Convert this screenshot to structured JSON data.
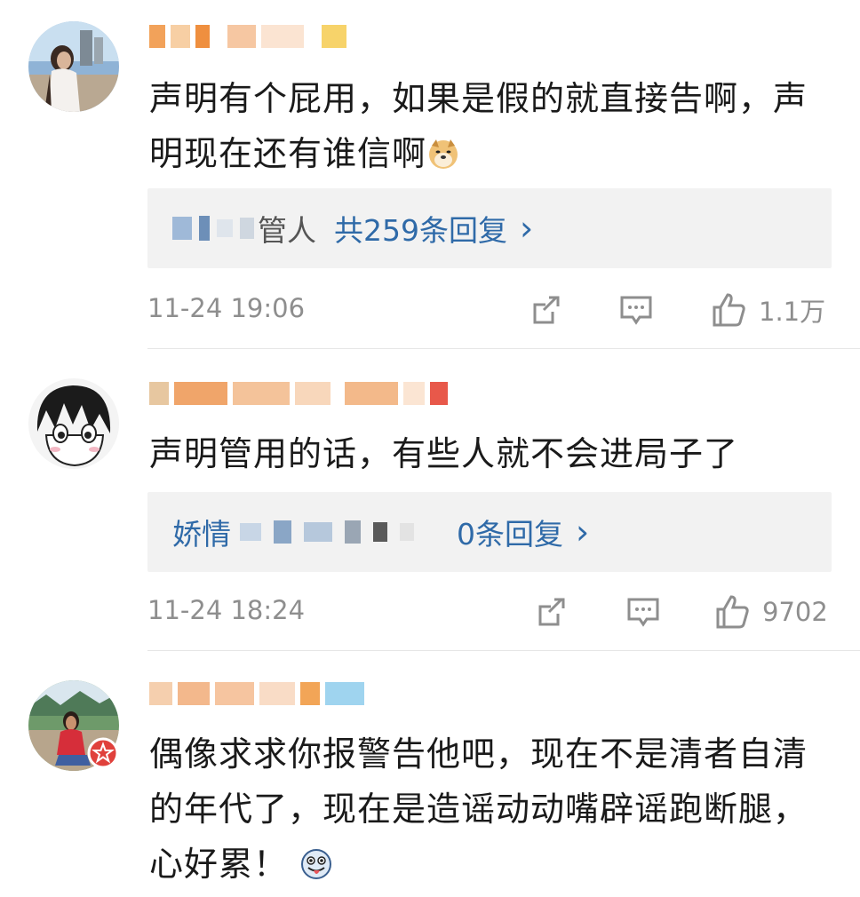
{
  "comments": [
    {
      "avatar_icon": "user-avatar-photo",
      "text_line1": "声明有个屁用，如果是假的就直接告啊，声",
      "text_line2": "明现在还有谁信啊",
      "text_emoji": "doge-emoji",
      "reply_author_visible": "管人",
      "reply_count": "共259条回复",
      "reply_arrow": "›",
      "time": "11-24 19:06",
      "likes": "1.1万"
    },
    {
      "avatar_icon": "anime-avatar",
      "text_line1": "声明管用的话，有些人就不会进局子了",
      "reply_author_visible": "娇情",
      "reply_count": "0条回复",
      "reply_arrow": "›",
      "time": "11-24 18:24",
      "likes": "9702"
    },
    {
      "avatar_icon": "user-avatar-photo",
      "badge_icon": "verified-star-badge",
      "text_line1": "偶像求求你报警告他吧，现在不是清者自清",
      "text_line2": "的年代了，现在是造谣动动嘴辟谣跑断腿，",
      "text_line3": "心好累！",
      "text_emoji": "tongue-out-emoji"
    }
  ],
  "colors": {
    "link": "#2f6aa8",
    "meta": "#8e8e8e",
    "reply_bg": "#f2f2f2",
    "divider": "#e6e6e6",
    "badge": "#e0413c"
  }
}
